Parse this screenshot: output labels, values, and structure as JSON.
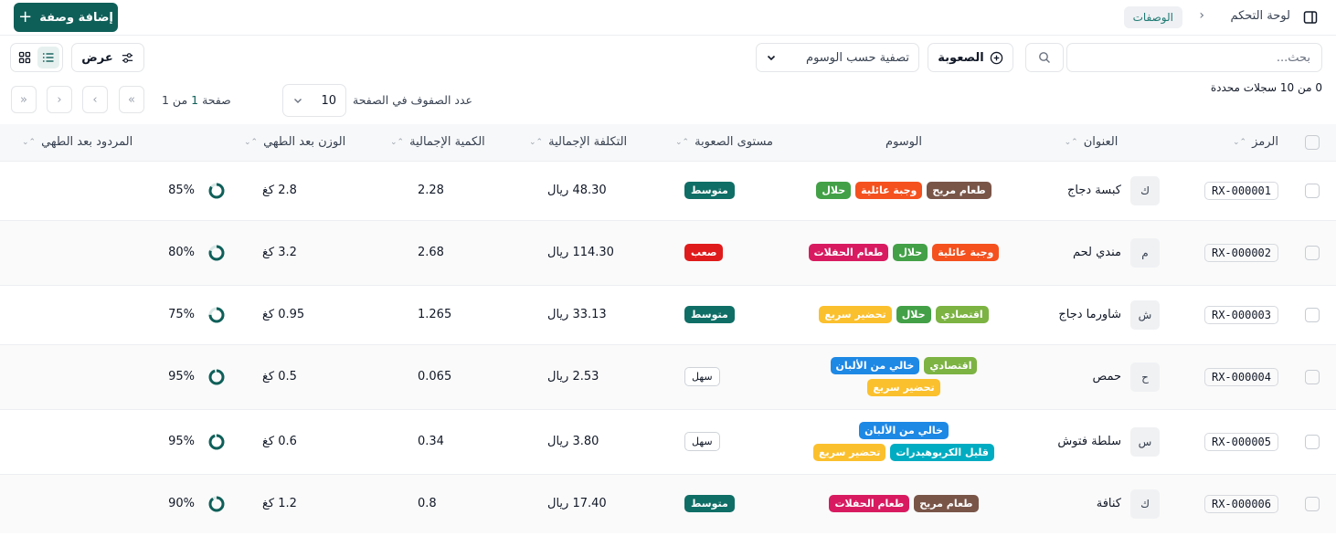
{
  "header": {
    "breadcrumb_home": "لوحة التحكم",
    "breadcrumb_current": "الوصفات",
    "add_button": "إضافة وصفة"
  },
  "toolbar": {
    "search_placeholder": "بحث...",
    "difficulty_filter": "الصعوبة",
    "tags_filter_placeholder": "تصفية حسب الوسوم",
    "view_button": "عرض"
  },
  "selection": {
    "text": "0 من 10 سجلات محددة"
  },
  "pagination": {
    "rows_per_page_label": "عدد الصفوف في الصفحة",
    "rows_per_page": "10",
    "page_prefix": "صفحة",
    "current_page": "1",
    "page_suffix": "من 1"
  },
  "columns": {
    "code": "الرمز",
    "title": "العنوان",
    "tags": "الوسوم",
    "difficulty": "مستوى الصعوبة",
    "total_cost": "التكلفة الإجمالية",
    "total_quantity": "الكمية الإجمالية",
    "cooked_weight": "الوزن بعد الطهي",
    "cooked_yield": "المردود بعد الطهي"
  },
  "colors": {
    "primary": "#0f5f59",
    "tag_comfort": "#795548",
    "tag_family": "#f4511e",
    "tag_halal": "#43a047",
    "tag_party": "#d81b60",
    "tag_economic": "#7cb342",
    "tag_quick": "#fbc02d",
    "tag_dairyfree": "#1e88e5",
    "tag_lowcarb": "#00acc1",
    "diff_medium": "#0f6e66",
    "diff_hard": "#e01b1b"
  },
  "rows": [
    {
      "code": "RX-000001",
      "avatar": "ك",
      "title": "كبسة دجاج",
      "tags": [
        {
          "label": "طعام مريح",
          "color": "#795548"
        },
        {
          "label": "وجبة عائلية",
          "color": "#f4511e"
        },
        {
          "label": "حلال",
          "color": "#43a047"
        }
      ],
      "difficulty": {
        "label": "متوسط",
        "style": "filled",
        "color": "#0f6e66"
      },
      "total_cost": "48.30 ريال",
      "total_quantity": "2.28",
      "cooked_weight": "2.8 كغ",
      "yield": "85%",
      "yield_value": 0.85
    },
    {
      "code": "RX-000002",
      "avatar": "م",
      "title": "مندي لحم",
      "tags": [
        {
          "label": "وجبة عائلية",
          "color": "#f4511e"
        },
        {
          "label": "حلال",
          "color": "#43a047"
        },
        {
          "label": "طعام الحفلات",
          "color": "#d81b60"
        }
      ],
      "difficulty": {
        "label": "صعب",
        "style": "filled",
        "color": "#e01b1b"
      },
      "total_cost": "114.30 ريال",
      "total_quantity": "2.68",
      "cooked_weight": "3.2 كغ",
      "yield": "80%",
      "yield_value": 0.8
    },
    {
      "code": "RX-000003",
      "avatar": "ش",
      "title": "شاورما دجاج",
      "tags": [
        {
          "label": "اقتصادي",
          "color": "#7cb342"
        },
        {
          "label": "حلال",
          "color": "#43a047"
        },
        {
          "label": "تحضير سريع",
          "color": "#fbc02d"
        }
      ],
      "difficulty": {
        "label": "متوسط",
        "style": "filled",
        "color": "#0f6e66"
      },
      "total_cost": "33.13 ريال",
      "total_quantity": "1.265",
      "cooked_weight": "0.95 كغ",
      "yield": "75%",
      "yield_value": 0.75
    },
    {
      "code": "RX-000004",
      "avatar": "ح",
      "title": "حمص",
      "tags": [
        {
          "label": "اقتصادي",
          "color": "#7cb342"
        },
        {
          "label": "خالي من الألبان",
          "color": "#1e88e5"
        },
        {
          "label": "تحضير سريع",
          "color": "#fbc02d"
        }
      ],
      "difficulty": {
        "label": "سهل",
        "style": "outline",
        "color": "#ffffff"
      },
      "total_cost": "2.53 ريال",
      "total_quantity": "0.065",
      "cooked_weight": "0.5 كغ",
      "yield": "95%",
      "yield_value": 0.95
    },
    {
      "code": "RX-000005",
      "avatar": "س",
      "title": "سلطة فتوش",
      "tags": [
        {
          "label": "خالي من الألبان",
          "color": "#1e88e5"
        },
        {
          "label": "قليل الكربوهيدرات",
          "color": "#00acc1"
        },
        {
          "label": "تحضير سريع",
          "color": "#fbc02d"
        }
      ],
      "difficulty": {
        "label": "سهل",
        "style": "outline",
        "color": "#ffffff"
      },
      "total_cost": "3.80 ريال",
      "total_quantity": "0.34",
      "cooked_weight": "0.6 كغ",
      "yield": "95%",
      "yield_value": 0.95
    },
    {
      "code": "RX-000006",
      "avatar": "ك",
      "title": "كنافة",
      "tags": [
        {
          "label": "طعام مريح",
          "color": "#795548"
        },
        {
          "label": "طعام الحفلات",
          "color": "#d81b60"
        }
      ],
      "difficulty": {
        "label": "متوسط",
        "style": "filled",
        "color": "#0f6e66"
      },
      "total_cost": "17.40 ريال",
      "total_quantity": "0.8",
      "cooked_weight": "1.2 كغ",
      "yield": "90%",
      "yield_value": 0.9
    }
  ]
}
